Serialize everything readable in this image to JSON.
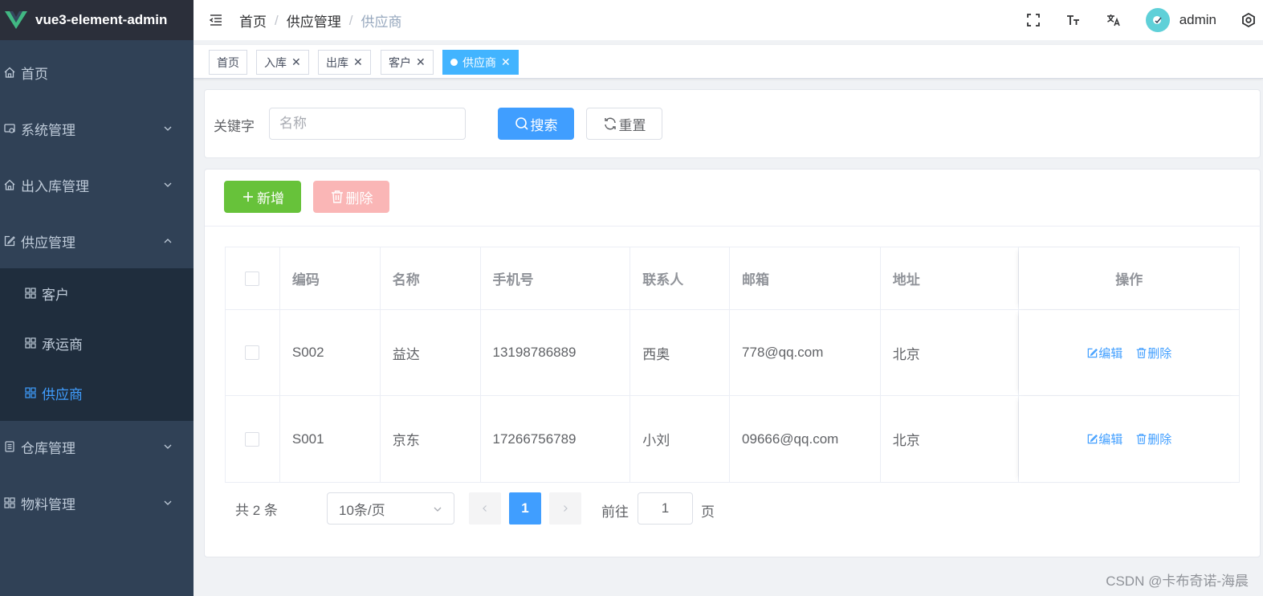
{
  "app": {
    "title": "vue3-element-admin"
  },
  "sidebar": {
    "items": [
      {
        "label": "首页",
        "icon": "home-icon"
      },
      {
        "label": "系统管理",
        "icon": "system-icon"
      },
      {
        "label": "出入库管理",
        "icon": "home-icon"
      },
      {
        "label": "供应管理",
        "icon": "edit-icon"
      },
      {
        "label": "客户",
        "icon": "grid-icon"
      },
      {
        "label": "承运商",
        "icon": "grid-icon"
      },
      {
        "label": "供应商",
        "icon": "grid-icon"
      },
      {
        "label": "仓库管理",
        "icon": "document-icon"
      },
      {
        "label": "物料管理",
        "icon": "grid-icon"
      }
    ]
  },
  "breadcrumb": [
    "首页",
    "供应管理",
    "供应商"
  ],
  "navbar": {
    "username": "admin"
  },
  "tags": [
    "首页",
    "入库",
    "出库",
    "客户",
    "供应商"
  ],
  "search": {
    "label": "关键字",
    "placeholder": "名称",
    "search_button": "搜索",
    "reset_button": "重置"
  },
  "toolbar": {
    "add_button": "新增",
    "delete_button": "删除"
  },
  "table": {
    "headers": [
      "编码",
      "名称",
      "手机号",
      "联系人",
      "邮箱",
      "地址",
      "操作"
    ],
    "rows": [
      {
        "code": "S002",
        "name": "益达",
        "phone": "13198786889",
        "contact": "西奥",
        "email": "778@qq.com",
        "address": "北京"
      },
      {
        "code": "S001",
        "name": "京东",
        "phone": "17266756789",
        "contact": "小刘",
        "email": "09666@qq.com",
        "address": "北京"
      }
    ],
    "edit_label": "编辑",
    "delete_label": "删除"
  },
  "pagination": {
    "total_text": "共 2 条",
    "page_size": "10条/页",
    "current_page": "1",
    "goto_label": "前往",
    "goto_value": "1",
    "page_suffix": "页"
  },
  "watermark": "CSDN @卡布奇诺-海晨",
  "colors": {
    "sidebar_bg": "#304156",
    "logo_bg": "#2b2f3a",
    "primary": "#409eff",
    "success": "#67c23a",
    "danger_disabled": "#fab6b6",
    "active_tag": "#42b4ff"
  }
}
